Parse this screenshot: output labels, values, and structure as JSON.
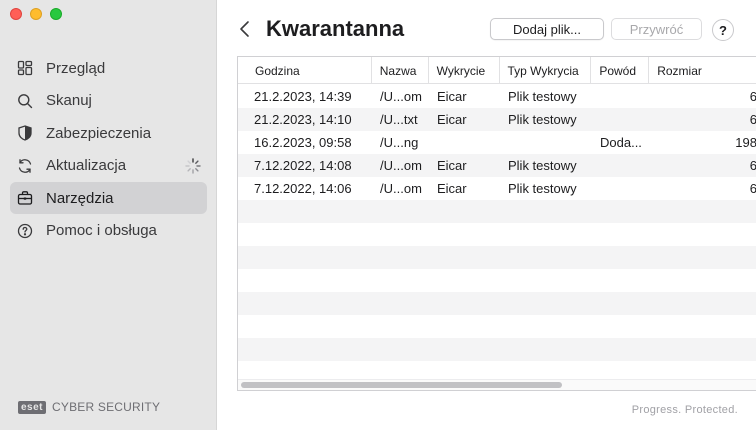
{
  "sidebar": {
    "items": [
      {
        "label": "Przegląd",
        "icon": "dashboard-icon"
      },
      {
        "label": "Skanuj",
        "icon": "search-icon"
      },
      {
        "label": "Zabezpieczenia",
        "icon": "shield-icon"
      },
      {
        "label": "Aktualizacja",
        "icon": "refresh-icon"
      },
      {
        "label": "Narzędzia",
        "icon": "toolbox-icon"
      },
      {
        "label": "Pomoc i obsługa",
        "icon": "help-icon"
      }
    ],
    "active_index": 4,
    "brand_logo": "eset",
    "brand_text": "CYBER SECURITY"
  },
  "header": {
    "title": "Kwarantanna",
    "add_button": "Dodaj plik...",
    "restore_button": "Przywróć",
    "help_button": "?"
  },
  "table": {
    "columns": [
      "Godzina",
      "Nazwa",
      "Wykrycie",
      "Typ Wykrycia",
      "Powód",
      "Rozmiar"
    ],
    "rows": [
      {
        "time": "21.2.2023, 14:39",
        "name": "/U...om",
        "detection": "Eicar",
        "type": "Plik testowy",
        "reason": "",
        "size": "6"
      },
      {
        "time": "21.2.2023, 14:10",
        "name": "/U...txt",
        "detection": "Eicar",
        "type": "Plik testowy",
        "reason": "",
        "size": "6"
      },
      {
        "time": "16.2.2023, 09:58",
        "name": "/U...ng",
        "detection": "",
        "type": "",
        "reason": "Doda...",
        "size": "198"
      },
      {
        "time": "7.12.2022, 14:08",
        "name": "/U...om",
        "detection": "Eicar",
        "type": "Plik testowy",
        "reason": "",
        "size": "6"
      },
      {
        "time": "7.12.2022, 14:06",
        "name": "/U...om",
        "detection": "Eicar",
        "type": "Plik testowy",
        "reason": "",
        "size": "6"
      }
    ]
  },
  "footer": {
    "tagline": "Progress. Protected."
  }
}
